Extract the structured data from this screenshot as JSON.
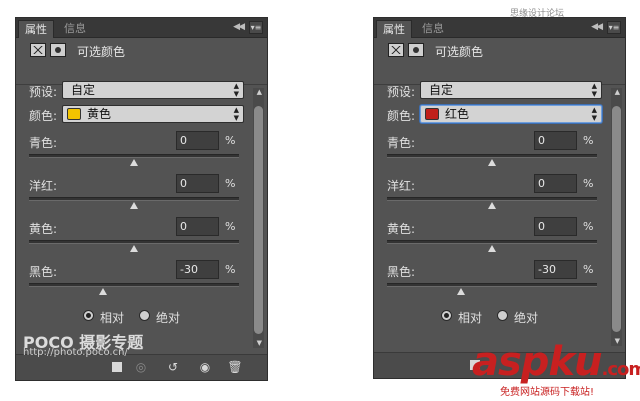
{
  "watermarks": {
    "top_site": "思缘设计论坛 www.missyuan.com",
    "poco_brand": "POCO 摄影专题",
    "poco_url": "http://photo.poco.cn/",
    "aspku": "aspku",
    "aspku_com": ".com",
    "aspku_sub": "免费网站源码下载站!"
  },
  "panels": [
    {
      "tabs": {
        "properties": "属性",
        "info": "信息"
      },
      "title": "可选颜色",
      "preset_label": "预设:",
      "preset_value": "自定",
      "colors_label": "颜色:",
      "colors_value": "黄色",
      "swatch_color": "#f2c400",
      "sliders": [
        {
          "label": "青色:",
          "value": "0",
          "unit": "%",
          "fraction": 0.5
        },
        {
          "label": "洋红:",
          "value": "0",
          "unit": "%",
          "fraction": 0.5
        },
        {
          "label": "黄色:",
          "value": "0",
          "unit": "%",
          "fraction": 0.5
        },
        {
          "label": "黑色:",
          "value": "-30",
          "unit": "%",
          "fraction": 0.35
        }
      ],
      "radio_relative": "相对",
      "radio_absolute": "绝对",
      "selected_mode": "relative",
      "bottom_icons": [
        "clip-to-layer-icon",
        "view-previous-state-icon",
        "reset-icon",
        "visibility-eye-icon",
        "trash-icon"
      ]
    },
    {
      "tabs": {
        "properties": "属性",
        "info": "信息"
      },
      "title": "可选颜色",
      "preset_label": "预设:",
      "preset_value": "自定",
      "colors_label": "颜色:",
      "colors_value": "红色",
      "swatch_color": "#c0201a",
      "sliders": [
        {
          "label": "青色:",
          "value": "0",
          "unit": "%",
          "fraction": 0.5
        },
        {
          "label": "洋红:",
          "value": "0",
          "unit": "%",
          "fraction": 0.5
        },
        {
          "label": "黄色:",
          "value": "0",
          "unit": "%",
          "fraction": 0.5
        },
        {
          "label": "黑色:",
          "value": "-30",
          "unit": "%",
          "fraction": 0.35
        }
      ],
      "radio_relative": "相对",
      "radio_absolute": "绝对",
      "selected_mode": "relative",
      "bottom_icons": [
        "clip-to-layer-icon"
      ]
    }
  ]
}
